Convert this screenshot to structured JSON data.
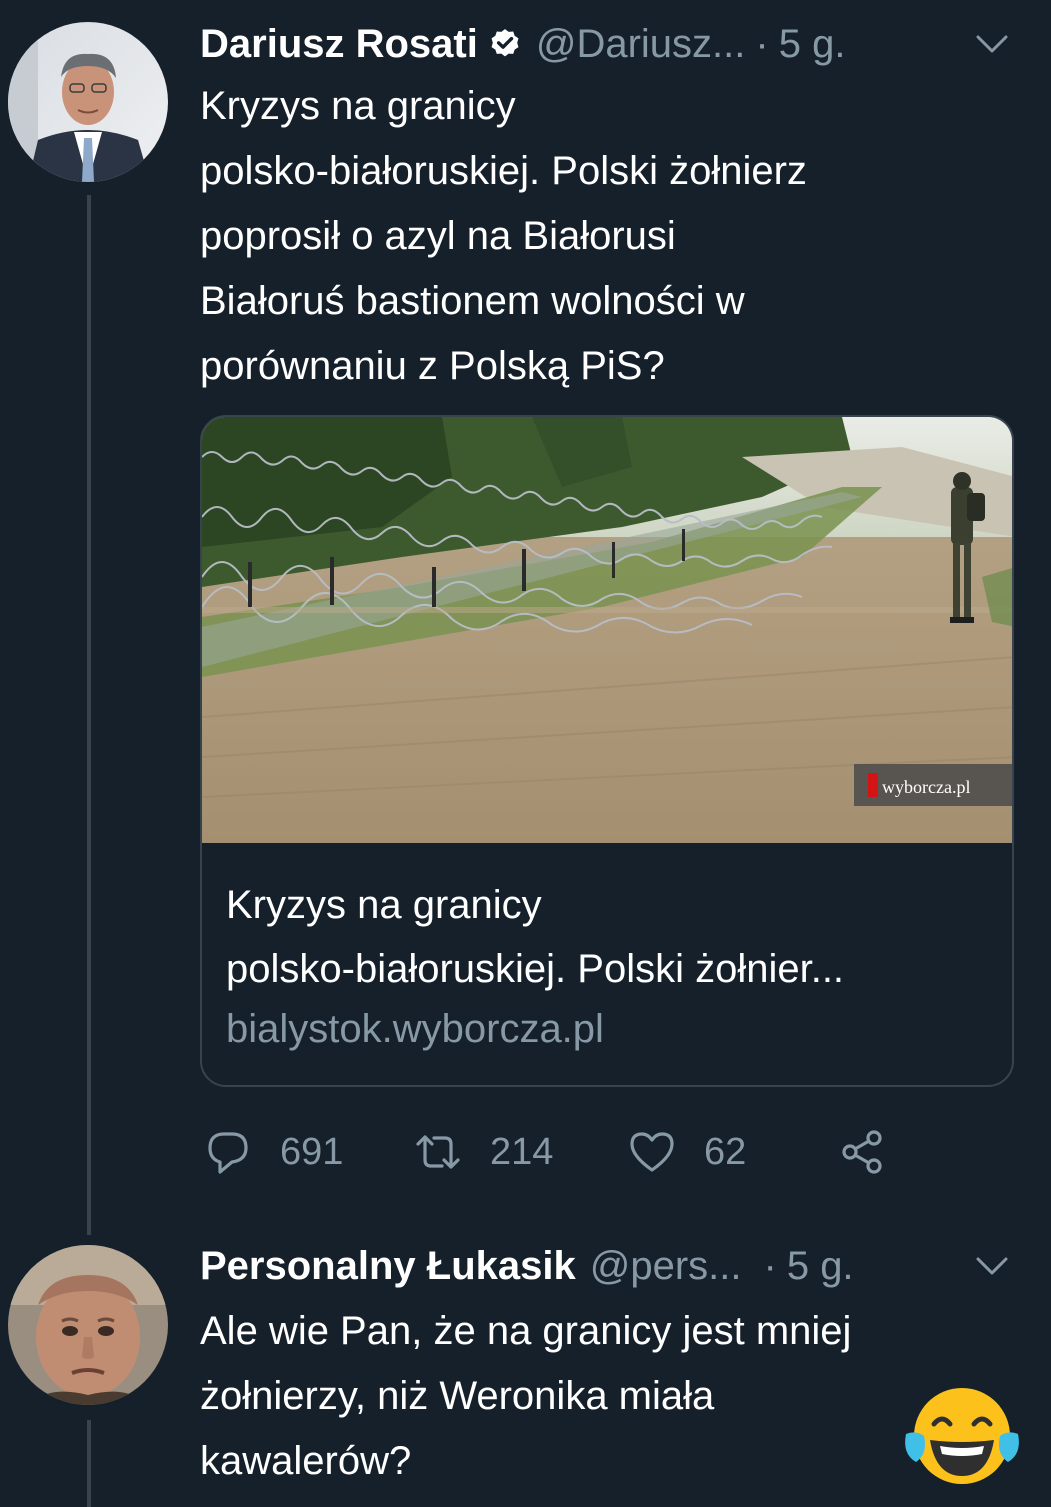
{
  "tweet1": {
    "author_name": "Dariusz Rosati",
    "handle": "@Dariusz...",
    "separator": "·",
    "time": "5 g.",
    "text_lines": [
      "Kryzys na granicy",
      "polsko-białoruskiej. Polski żołnierz",
      "poprosił o azyl na Białorusi",
      "Białoruś bastionem wolności w",
      "porównaniu z Polską PiS?"
    ],
    "card": {
      "image_watermark": "wyborcza.pl",
      "title_lines": [
        "Kryzys na granicy",
        "polsko-białoruskiej. Polski żołnier..."
      ],
      "domain": "bialystok.wyborcza.pl"
    },
    "actions": {
      "replies": "691",
      "retweets": "214",
      "likes": "62"
    }
  },
  "tweet2": {
    "author_name": "Personalny Łukasik",
    "handle": "@pers...",
    "separator": "·",
    "time": "5 g.",
    "text_lines": [
      "Ale wie Pan, że na granicy jest mniej",
      "żołnierzy, niż Weronika miała",
      "kawalerów?"
    ],
    "emoji": "face-with-tears-of-joy"
  },
  "colors": {
    "background": "#15202b",
    "text_primary": "#ffffff",
    "text_secondary": "#8899a6",
    "border": "#38444d"
  }
}
